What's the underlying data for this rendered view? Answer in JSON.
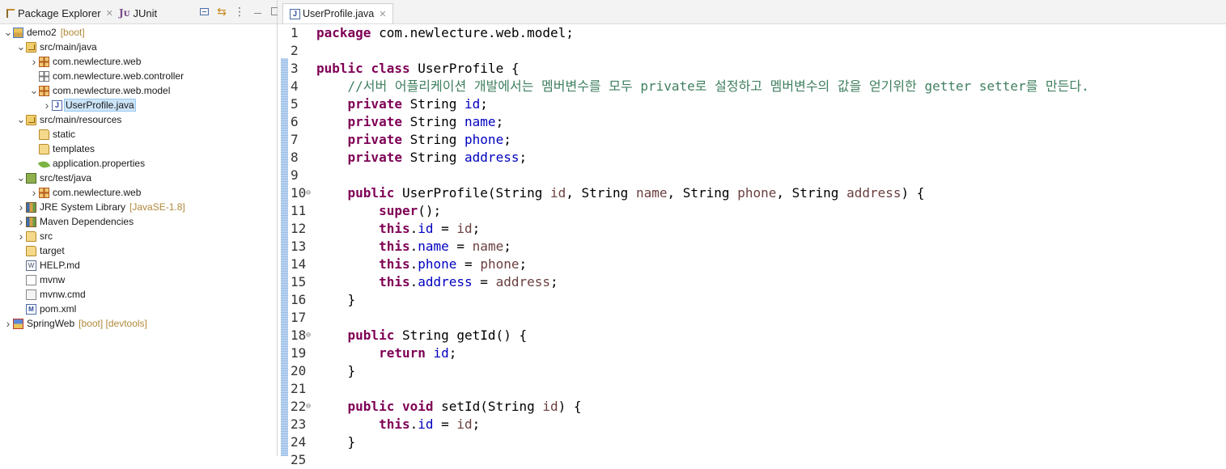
{
  "left_panel": {
    "tabs": [
      {
        "label": "Package Explorer",
        "icon": "package-explorer-icon",
        "active": true
      },
      {
        "label": "JUnit",
        "icon": "junit-icon",
        "active": false
      }
    ],
    "toolbar": [
      "collapse-all-icon",
      "link-with-editor-icon",
      "view-menu-icon",
      "minimize-icon",
      "maximize-icon"
    ]
  },
  "tree": {
    "items": [
      {
        "label": "demo2",
        "decor": "[boot]",
        "icon": "project-icon",
        "expanded": true
      },
      {
        "label": "src/main/java",
        "decor": "",
        "icon": "source-folder-icon",
        "expanded": true
      },
      {
        "label": "com.newlecture.web",
        "decor": "",
        "icon": "package-icon",
        "expanded": false
      },
      {
        "label": "com.newlecture.web.controller",
        "decor": "",
        "icon": "empty-package-icon",
        "expanded": null
      },
      {
        "label": "com.newlecture.web.model",
        "decor": "",
        "icon": "package-icon",
        "expanded": true
      },
      {
        "label": "UserProfile.java",
        "decor": "",
        "icon": "java-file-icon",
        "expanded": false,
        "selected": true
      },
      {
        "label": "src/main/resources",
        "decor": "",
        "icon": "source-folder-icon",
        "expanded": true
      },
      {
        "label": "static",
        "decor": "",
        "icon": "folder-icon",
        "expanded": null
      },
      {
        "label": "templates",
        "decor": "",
        "icon": "folder-icon",
        "expanded": null
      },
      {
        "label": "application.properties",
        "decor": "",
        "icon": "properties-leaf-icon",
        "expanded": null
      },
      {
        "label": "src/test/java",
        "decor": "",
        "icon": "test-source-folder-icon",
        "expanded": true
      },
      {
        "label": "com.newlecture.web",
        "decor": "",
        "icon": "package-icon",
        "expanded": false
      },
      {
        "label": "JRE System Library",
        "decor": "[JavaSE-1.8]",
        "icon": "library-icon",
        "expanded": false
      },
      {
        "label": "Maven Dependencies",
        "decor": "",
        "icon": "library-icon",
        "expanded": false
      },
      {
        "label": "src",
        "decor": "",
        "icon": "folder-icon",
        "expanded": false
      },
      {
        "label": "target",
        "decor": "",
        "icon": "folder-icon",
        "expanded": null
      },
      {
        "label": "HELP.md",
        "decor": "",
        "icon": "markdown-file-icon",
        "expanded": null
      },
      {
        "label": "mvnw",
        "decor": "",
        "icon": "file-icon",
        "expanded": null
      },
      {
        "label": "mvnw.cmd",
        "decor": "",
        "icon": "cmd-file-icon",
        "expanded": null
      },
      {
        "label": "pom.xml",
        "decor": "",
        "icon": "xml-file-icon",
        "expanded": null
      },
      {
        "label": "SpringWeb",
        "decor": "[boot] [devtools]",
        "icon": "project-error-icon",
        "expanded": false
      }
    ]
  },
  "editor": {
    "tab": {
      "label": "UserProfile.java",
      "icon": "java-file-icon"
    },
    "lines": [
      {
        "n": "1",
        "fold": "",
        "tokens": [
          [
            "kw",
            "package"
          ],
          [
            "",
            " com.newlecture.web.model;"
          ]
        ]
      },
      {
        "n": "2",
        "fold": "",
        "tokens": []
      },
      {
        "n": "3",
        "fold": "",
        "tokens": [
          [
            "kw",
            "public"
          ],
          [
            "",
            " "
          ],
          [
            "kw",
            "class"
          ],
          [
            "",
            " UserProfile {"
          ]
        ]
      },
      {
        "n": "4",
        "fold": "",
        "tokens": [
          [
            "",
            "    "
          ],
          [
            "cmt",
            "//서버 어플리케이션 개발에서는 멤버변수를 모두 private로 설정하고 멤버변수의 값을 얻기위한 getter setter를 만든다."
          ]
        ]
      },
      {
        "n": "5",
        "fold": "",
        "tokens": [
          [
            "",
            "    "
          ],
          [
            "kw",
            "private"
          ],
          [
            "",
            " String "
          ],
          [
            "fld",
            "id"
          ],
          [
            "",
            ";"
          ]
        ]
      },
      {
        "n": "6",
        "fold": "",
        "tokens": [
          [
            "",
            "    "
          ],
          [
            "kw",
            "private"
          ],
          [
            "",
            " String "
          ],
          [
            "fld",
            "name"
          ],
          [
            "",
            ";"
          ]
        ]
      },
      {
        "n": "7",
        "fold": "",
        "tokens": [
          [
            "",
            "    "
          ],
          [
            "kw",
            "private"
          ],
          [
            "",
            " String "
          ],
          [
            "fld",
            "phone"
          ],
          [
            "",
            ";"
          ]
        ]
      },
      {
        "n": "8",
        "fold": "",
        "tokens": [
          [
            "",
            "    "
          ],
          [
            "kw",
            "private"
          ],
          [
            "",
            " String "
          ],
          [
            "fld",
            "address"
          ],
          [
            "",
            ";"
          ]
        ]
      },
      {
        "n": "9",
        "fold": "",
        "tokens": []
      },
      {
        "n": "10",
        "fold": "⊖",
        "tokens": [
          [
            "",
            "    "
          ],
          [
            "kw",
            "public"
          ],
          [
            "",
            " UserProfile(String "
          ],
          [
            "prm",
            "id"
          ],
          [
            "",
            ", String "
          ],
          [
            "prm",
            "name"
          ],
          [
            "",
            ", String "
          ],
          [
            "prm",
            "phone"
          ],
          [
            "",
            ", String "
          ],
          [
            "prm",
            "address"
          ],
          [
            "",
            ") {"
          ]
        ]
      },
      {
        "n": "11",
        "fold": "",
        "tokens": [
          [
            "",
            "        "
          ],
          [
            "kw",
            "super"
          ],
          [
            "",
            "();"
          ]
        ]
      },
      {
        "n": "12",
        "fold": "",
        "tokens": [
          [
            "",
            "        "
          ],
          [
            "kw",
            "this"
          ],
          [
            "",
            "."
          ],
          [
            "fld",
            "id"
          ],
          [
            "",
            " = "
          ],
          [
            "prm",
            "id"
          ],
          [
            "",
            ";"
          ]
        ]
      },
      {
        "n": "13",
        "fold": "",
        "tokens": [
          [
            "",
            "        "
          ],
          [
            "kw",
            "this"
          ],
          [
            "",
            "."
          ],
          [
            "fld",
            "name"
          ],
          [
            "",
            " = "
          ],
          [
            "prm",
            "name"
          ],
          [
            "",
            ";"
          ]
        ]
      },
      {
        "n": "14",
        "fold": "",
        "tokens": [
          [
            "",
            "        "
          ],
          [
            "kw",
            "this"
          ],
          [
            "",
            "."
          ],
          [
            "fld",
            "phone"
          ],
          [
            "",
            " = "
          ],
          [
            "prm",
            "phone"
          ],
          [
            "",
            ";"
          ]
        ]
      },
      {
        "n": "15",
        "fold": "",
        "tokens": [
          [
            "",
            "        "
          ],
          [
            "kw",
            "this"
          ],
          [
            "",
            "."
          ],
          [
            "fld",
            "address"
          ],
          [
            "",
            " = "
          ],
          [
            "prm",
            "address"
          ],
          [
            "",
            ";"
          ]
        ]
      },
      {
        "n": "16",
        "fold": "",
        "tokens": [
          [
            "",
            "    }"
          ]
        ]
      },
      {
        "n": "17",
        "fold": "",
        "tokens": []
      },
      {
        "n": "18",
        "fold": "⊖",
        "tokens": [
          [
            "",
            "    "
          ],
          [
            "kw",
            "public"
          ],
          [
            "",
            " String getId() {"
          ]
        ]
      },
      {
        "n": "19",
        "fold": "",
        "tokens": [
          [
            "",
            "        "
          ],
          [
            "kw",
            "return"
          ],
          [
            "",
            " "
          ],
          [
            "fld",
            "id"
          ],
          [
            "",
            ";"
          ]
        ]
      },
      {
        "n": "20",
        "fold": "",
        "tokens": [
          [
            "",
            "    }"
          ]
        ]
      },
      {
        "n": "21",
        "fold": "",
        "tokens": []
      },
      {
        "n": "22",
        "fold": "⊖",
        "tokens": [
          [
            "",
            "    "
          ],
          [
            "kw",
            "public"
          ],
          [
            "",
            " "
          ],
          [
            "kw",
            "void"
          ],
          [
            "",
            " setId(String "
          ],
          [
            "prm",
            "id"
          ],
          [
            "",
            ") {"
          ]
        ]
      },
      {
        "n": "23",
        "fold": "",
        "tokens": [
          [
            "",
            "        "
          ],
          [
            "kw",
            "this"
          ],
          [
            "",
            "."
          ],
          [
            "fld",
            "id"
          ],
          [
            "",
            " = "
          ],
          [
            "prm",
            "id"
          ],
          [
            "",
            ";"
          ]
        ]
      },
      {
        "n": "24",
        "fold": "",
        "tokens": [
          [
            "",
            "    }"
          ]
        ]
      },
      {
        "n": "25",
        "fold": "",
        "tokens": []
      }
    ]
  },
  "colors": {
    "keyword": "#7f0055",
    "field": "#0000c0",
    "parameter": "#6a3e3e",
    "comment": "#3f7f5f",
    "decoration": "#b0893a",
    "selection": "#cce4f7"
  }
}
